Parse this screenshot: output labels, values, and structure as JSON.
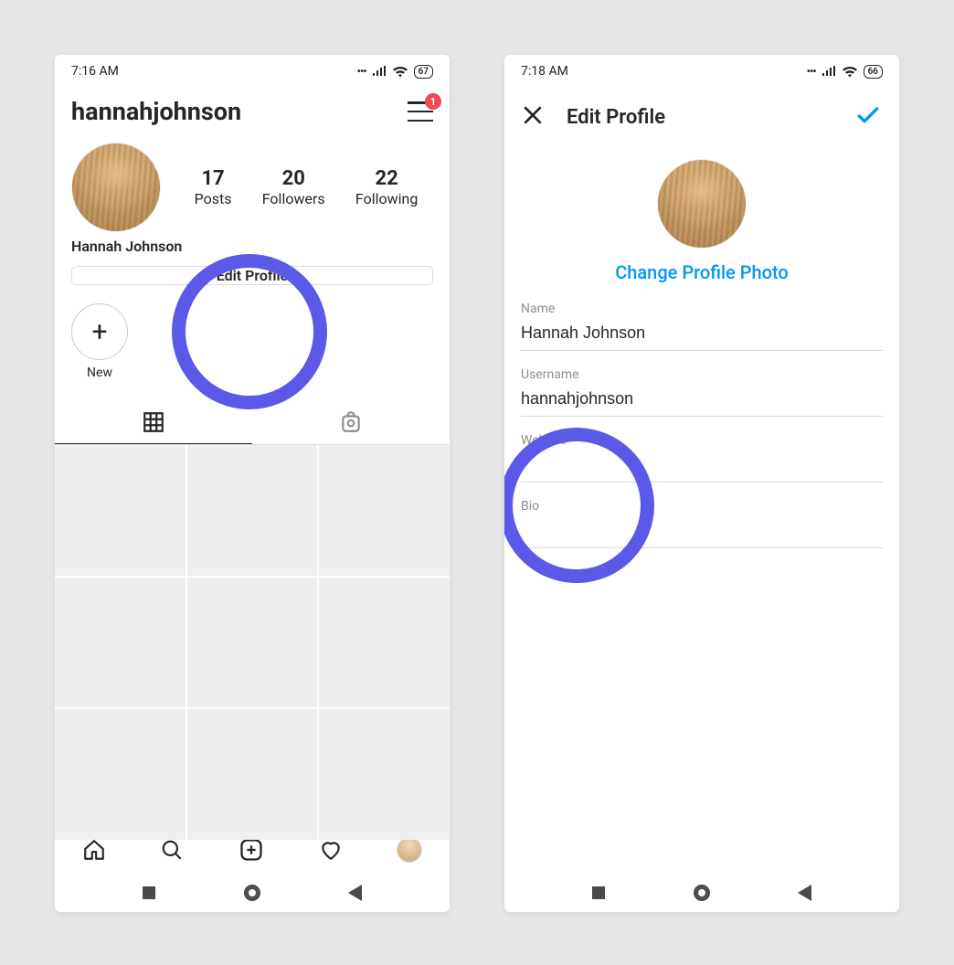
{
  "left": {
    "status": {
      "time": "7:16 AM",
      "battery": "67"
    },
    "username": "hannahjohnson",
    "notif_count": "1",
    "stats": {
      "posts_num": "17",
      "posts_lbl": "Posts",
      "followers_num": "20",
      "followers_lbl": "Followers",
      "following_num": "22",
      "following_lbl": "Following"
    },
    "display_name": "Hannah Johnson",
    "edit_btn": "Edit Profile",
    "highlight_new": "New"
  },
  "right": {
    "status": {
      "time": "7:18 AM",
      "battery": "66"
    },
    "title": "Edit Profile",
    "change_photo": "Change Profile Photo",
    "fields": {
      "name_lbl": "Name",
      "name_val": "Hannah Johnson",
      "username_lbl": "Username",
      "username_val": "hannahjohnson",
      "website_lbl": "Website",
      "website_val": "",
      "bio_lbl": "Bio",
      "bio_val": ""
    }
  }
}
